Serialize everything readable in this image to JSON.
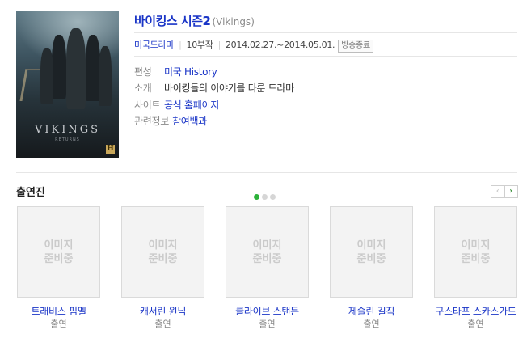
{
  "poster": {
    "title_art": "VIKINGS",
    "subtitle_art": "RETURNS",
    "network_logo": "H"
  },
  "title": {
    "ko": "바이킹스 시즌2",
    "en": "(Vikings)"
  },
  "meta": {
    "genre": "미국드라마",
    "episodes": "10부작",
    "period": "2014.02.27.~2014.05.01.",
    "status_badge": "방송종료"
  },
  "info": [
    {
      "label": "편성",
      "value": "미국 History",
      "link": true
    },
    {
      "label": "소개",
      "value": "바이킹들의 이야기를 다룬 드라마",
      "link": false
    },
    {
      "label": "사이트",
      "value": "공식 홈페이지",
      "link": true
    },
    {
      "label": "관련정보",
      "value": "참여백과",
      "link": true
    }
  ],
  "cast_section": {
    "title": "출연진",
    "page_dots": 3,
    "active_dot": 0
  },
  "placeholder_text": "이미지\n준비중",
  "cast": [
    {
      "name": "트래비스 핌멜",
      "role": "출연"
    },
    {
      "name": "캐서린 윈닉",
      "role": "출연"
    },
    {
      "name": "클라이브 스탠든",
      "role": "출연"
    },
    {
      "name": "제슬린 길직",
      "role": "출연"
    },
    {
      "name": "구스타프 스카스가드",
      "role": "출연"
    }
  ],
  "pager": {
    "prev": "‹",
    "next": "›"
  },
  "colors": {
    "link": "#1a35c7",
    "active_dot": "#2cb23a",
    "next_arrow": "#2f8a2f"
  }
}
